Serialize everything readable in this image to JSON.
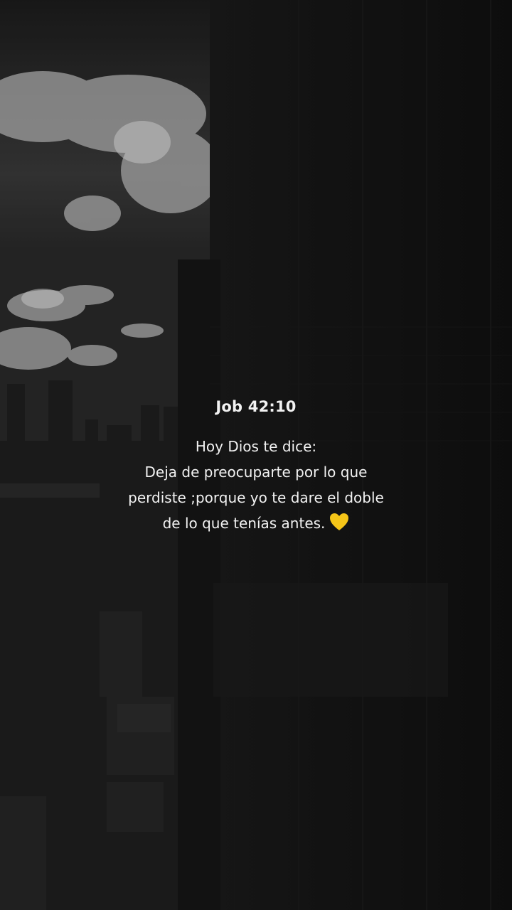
{
  "quote": {
    "reference": "Job 42:10",
    "lines": [
      "Hoy Dios te dice:",
      "Deja de preocuparte por lo que",
      "perdiste ;porque yo te dare el doble",
      "de lo que tenías antes."
    ],
    "emoji": "yellow-heart-icon"
  },
  "colors": {
    "text": "#f2f2f2",
    "heart": "#f5c518",
    "background": "#121212"
  }
}
